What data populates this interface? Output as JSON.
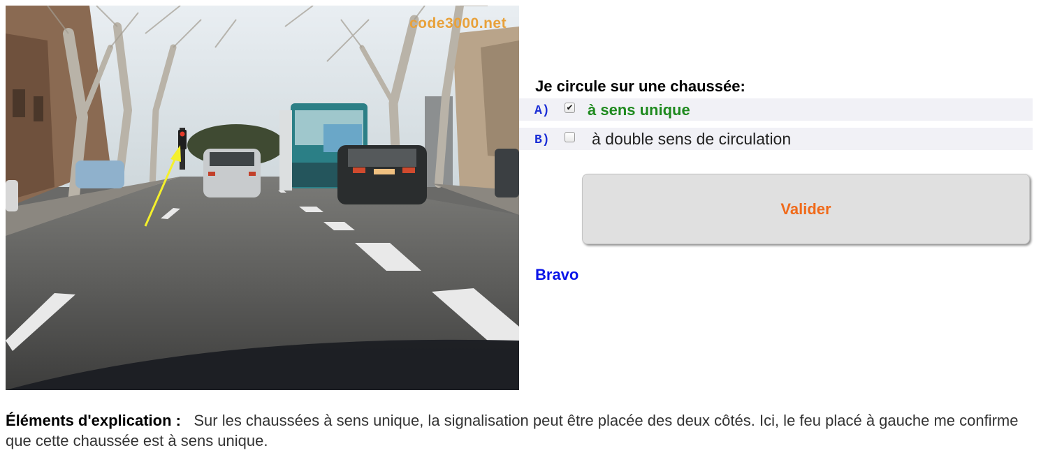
{
  "photo": {
    "watermark": "code3000.net",
    "description_icon": "road-scene-photo"
  },
  "question": {
    "title": "Je circule sur une chaussée:",
    "answers": [
      {
        "letter": "A)",
        "text": "à sens unique",
        "checked": true,
        "color": "#1f8a1f"
      },
      {
        "letter": "B)",
        "text": "à double sens de circulation",
        "checked": false,
        "color": "#222222"
      }
    ]
  },
  "validate_label": "Valider",
  "feedback": "Bravo",
  "explanation": {
    "label": "Éléments d'explication :",
    "text": "Sur les chaussées à sens unique, la signalisation peut être placée des deux côtés. Ici, le feu placé à gauche me confirme que cette chaussée est à sens unique."
  },
  "colors": {
    "letter": "#1c2fd6",
    "validate_text": "#f06a1a",
    "feedback": "#0a14e8",
    "row_background": "#f1f1f6"
  }
}
